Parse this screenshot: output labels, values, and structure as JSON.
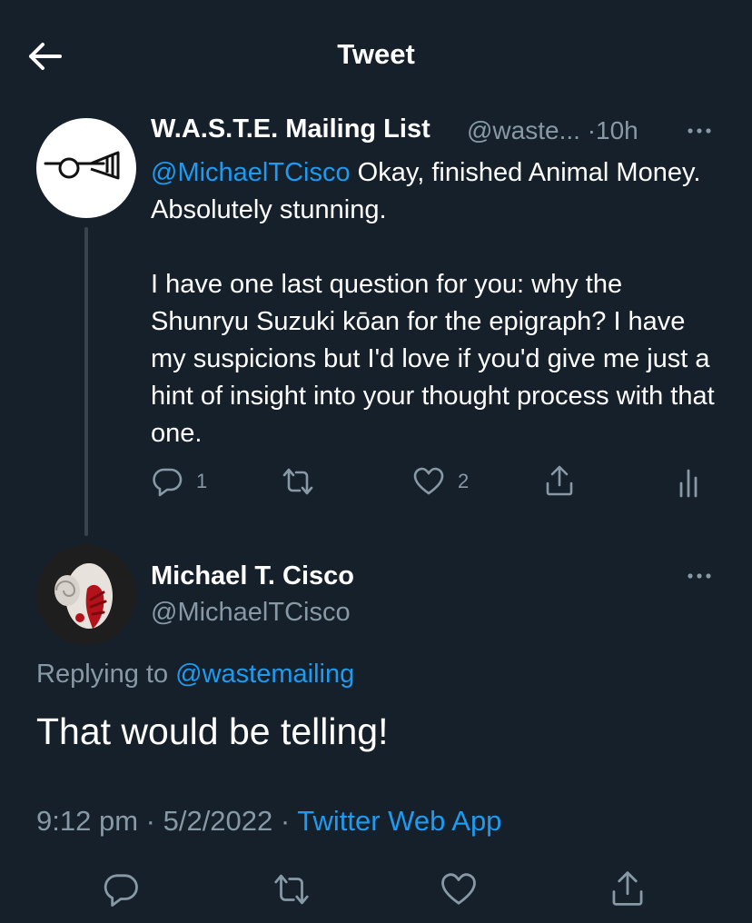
{
  "header": {
    "title": "Tweet"
  },
  "icons": {
    "back": "arrow-left-icon",
    "more": "more-horizontal-icon",
    "reply": "reply-icon",
    "retweet": "retweet-icon",
    "like": "heart-icon",
    "share": "share-icon",
    "analytics": "analytics-icon"
  },
  "colors": {
    "background": "#15202b",
    "text": "#ffffff",
    "muted": "#8899a6",
    "accent": "#1d9bf0",
    "thread_line": "#38444d"
  },
  "parent_tweet": {
    "display_name": "W.A.S.T.E. Mailing List",
    "handle": "@waste...",
    "separator": "·",
    "time": "10h",
    "mention": "@MichaelTCisco",
    "text_first": "Okay, finished Animal Money. Absolutely stunning.",
    "text_second": "I have one last question for you: why the Shunryu Suzuki kōan for the epigraph? I have my suspicions but I'd love if you'd give me just a hint of insight into your thought process with that one.",
    "reply_count": "1",
    "like_count": "2"
  },
  "main_tweet": {
    "display_name": "Michael T. Cisco",
    "handle": "@MichaelTCisco",
    "replying_label": "Replying to",
    "replying_to": "@wastemailing",
    "text": "That would be telling!",
    "time": "9:12 pm",
    "date": "5/2/2022",
    "separator": "·",
    "source": "Twitter Web App"
  }
}
